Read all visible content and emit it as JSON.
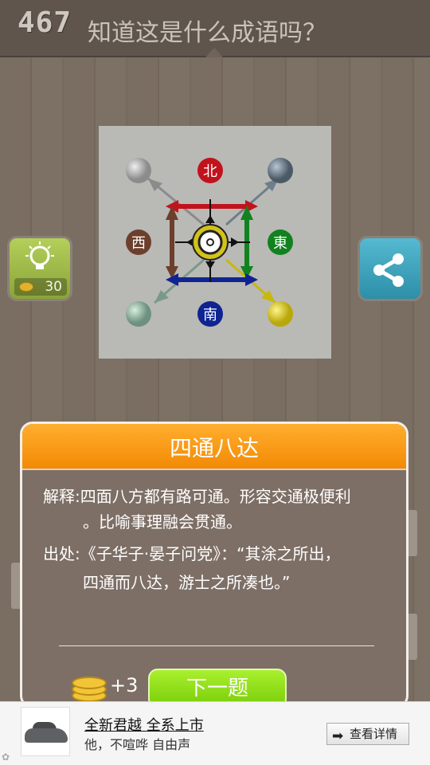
{
  "header": {
    "level": "467",
    "question": "知道这是什么成语吗？"
  },
  "puzzle": {
    "labels": {
      "north": "北",
      "south": "南",
      "west": "西",
      "east": "東"
    },
    "colors": {
      "north": "#c1131c",
      "south": "#0f2391",
      "west": "#6c3f2c",
      "east": "#11821f",
      "ne": "#788894",
      "nw": "#a6a6a6",
      "sw": "#8aa898",
      "se": "#d1c315"
    }
  },
  "hint": {
    "cost": "30",
    "icon": "lightbulb-icon",
    "coin_icon": "coins-icon"
  },
  "share": {
    "icon": "share-icon"
  },
  "dialog": {
    "title": "四通八达",
    "explanation_label": "解释:",
    "explanation_line1": "四面八方都有路可通。形容交通极便利",
    "explanation_line2": "。比喻事理融会贯通。",
    "source_label": "出处:",
    "source_line1": "《子华子·晏子问党》：“其涂之所出，",
    "source_line2": "四通而八达，游士之所凑也。”",
    "reward": "+3",
    "next_label": "下一题"
  },
  "ad": {
    "title": "全新君越 全系上市",
    "subtitle": "他，不喧哗 自由声",
    "button": "查看详情"
  }
}
